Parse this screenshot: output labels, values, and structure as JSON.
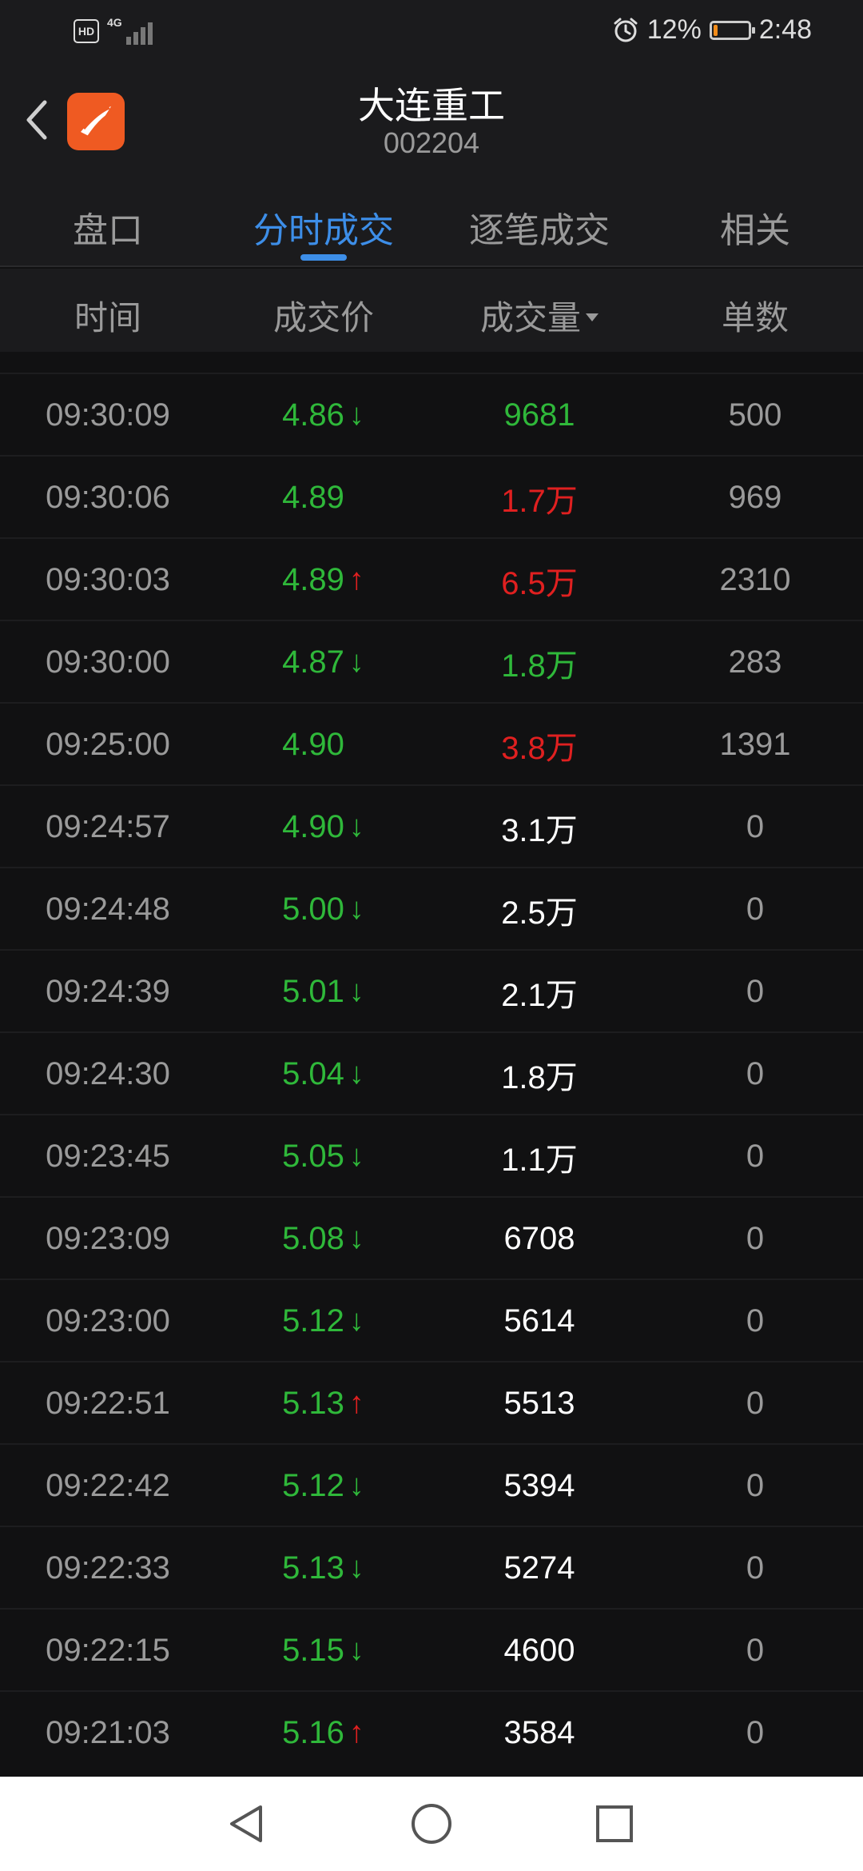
{
  "status_bar": {
    "hd": "HD",
    "network": "4G",
    "alarm_icon": "alarm-icon",
    "battery_percent": "12%",
    "battery_level": 0.12,
    "time": "2:48"
  },
  "header": {
    "title": "大连重工",
    "code": "002204"
  },
  "tabs": [
    {
      "label": "盘口",
      "active": false
    },
    {
      "label": "分时成交",
      "active": true
    },
    {
      "label": "逐笔成交",
      "active": false
    },
    {
      "label": "相关",
      "active": false
    }
  ],
  "columns": {
    "time": "时间",
    "price": "成交价",
    "volume": "成交量",
    "count": "单数"
  },
  "colors": {
    "green": "#2fb83a",
    "red": "#e02020",
    "white": "#ffffff",
    "accent": "#3d8ee8"
  },
  "rows": [
    {
      "time": "09:30:09",
      "price": "4.86",
      "arrow": "down",
      "volume": "9681",
      "volume_color": "green",
      "count": "500"
    },
    {
      "time": "09:30:06",
      "price": "4.89",
      "arrow": "none",
      "volume": "1.7万",
      "volume_color": "red",
      "count": "969"
    },
    {
      "time": "09:30:03",
      "price": "4.89",
      "arrow": "up",
      "volume": "6.5万",
      "volume_color": "red",
      "count": "2310"
    },
    {
      "time": "09:30:00",
      "price": "4.87",
      "arrow": "down",
      "volume": "1.8万",
      "volume_color": "green",
      "count": "283"
    },
    {
      "time": "09:25:00",
      "price": "4.90",
      "arrow": "none",
      "volume": "3.8万",
      "volume_color": "red",
      "count": "1391"
    },
    {
      "time": "09:24:57",
      "price": "4.90",
      "arrow": "down",
      "volume": "3.1万",
      "volume_color": "white",
      "count": "0"
    },
    {
      "time": "09:24:48",
      "price": "5.00",
      "arrow": "down",
      "volume": "2.5万",
      "volume_color": "white",
      "count": "0"
    },
    {
      "time": "09:24:39",
      "price": "5.01",
      "arrow": "down",
      "volume": "2.1万",
      "volume_color": "white",
      "count": "0"
    },
    {
      "time": "09:24:30",
      "price": "5.04",
      "arrow": "down",
      "volume": "1.8万",
      "volume_color": "white",
      "count": "0"
    },
    {
      "time": "09:23:45",
      "price": "5.05",
      "arrow": "down",
      "volume": "1.1万",
      "volume_color": "white",
      "count": "0"
    },
    {
      "time": "09:23:09",
      "price": "5.08",
      "arrow": "down",
      "volume": "6708",
      "volume_color": "white",
      "count": "0"
    },
    {
      "time": "09:23:00",
      "price": "5.12",
      "arrow": "down",
      "volume": "5614",
      "volume_color": "white",
      "count": "0"
    },
    {
      "time": "09:22:51",
      "price": "5.13",
      "arrow": "up",
      "volume": "5513",
      "volume_color": "white",
      "count": "0"
    },
    {
      "time": "09:22:42",
      "price": "5.12",
      "arrow": "down",
      "volume": "5394",
      "volume_color": "white",
      "count": "0"
    },
    {
      "time": "09:22:33",
      "price": "5.13",
      "arrow": "down",
      "volume": "5274",
      "volume_color": "white",
      "count": "0"
    },
    {
      "time": "09:22:15",
      "price": "5.15",
      "arrow": "down",
      "volume": "4600",
      "volume_color": "white",
      "count": "0"
    },
    {
      "time": "09:21:03",
      "price": "5.16",
      "arrow": "up",
      "volume": "3584",
      "volume_color": "white",
      "count": "0"
    }
  ],
  "nav": {
    "back_icon": "triangle-back-icon",
    "home_icon": "circle-home-icon",
    "recents_icon": "square-recents-icon"
  }
}
